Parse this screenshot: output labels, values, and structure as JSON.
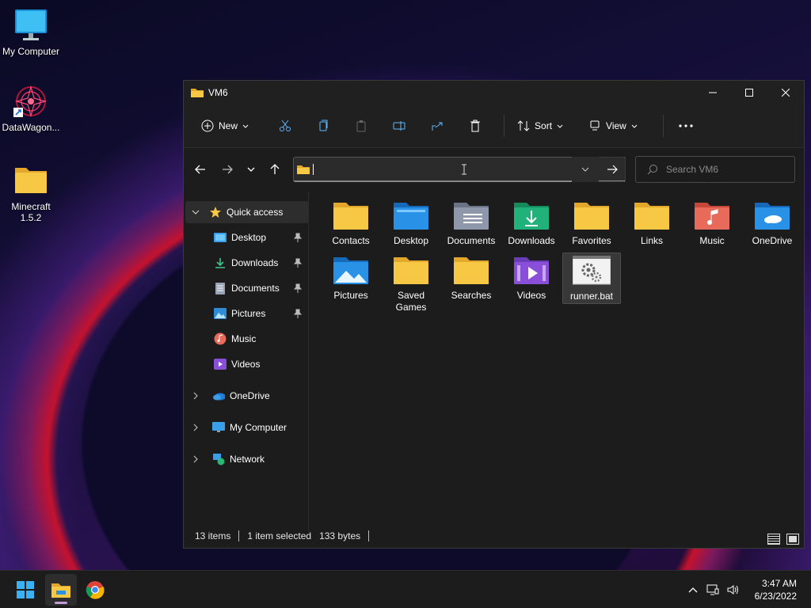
{
  "desktop": {
    "icons": [
      {
        "label": "My Computer"
      },
      {
        "label": "DataWagon..."
      },
      {
        "label": "Minecraft 1.5.2"
      }
    ]
  },
  "window": {
    "title": "VM6",
    "toolbar": {
      "new_label": "New",
      "sort_label": "Sort",
      "view_label": "View"
    },
    "address": {
      "value": ""
    },
    "search": {
      "placeholder": "Search VM6"
    },
    "nav": {
      "quick_access": "Quick access",
      "items": [
        {
          "label": "Desktop"
        },
        {
          "label": "Downloads"
        },
        {
          "label": "Documents"
        },
        {
          "label": "Pictures"
        },
        {
          "label": "Music"
        },
        {
          "label": "Videos"
        }
      ],
      "onedrive": "OneDrive",
      "my_computer": "My Computer",
      "network": "Network"
    },
    "files": [
      {
        "label": "Contacts"
      },
      {
        "label": "Desktop"
      },
      {
        "label": "Documents"
      },
      {
        "label": "Downloads"
      },
      {
        "label": "Favorites"
      },
      {
        "label": "Links"
      },
      {
        "label": "Music"
      },
      {
        "label": "OneDrive"
      },
      {
        "label": "Pictures"
      },
      {
        "label": "Saved Games"
      },
      {
        "label": "Searches"
      },
      {
        "label": "Videos"
      },
      {
        "label": "runner.bat"
      }
    ],
    "status": {
      "items": "13 items",
      "selected": "1 item selected",
      "size": "133 bytes"
    }
  },
  "taskbar": {
    "time": "3:47 AM",
    "date": "6/23/2022"
  },
  "colors": {
    "folder": "#f6c844",
    "folder_dark": "#e3a82b",
    "accent": "#4cc2ff"
  }
}
